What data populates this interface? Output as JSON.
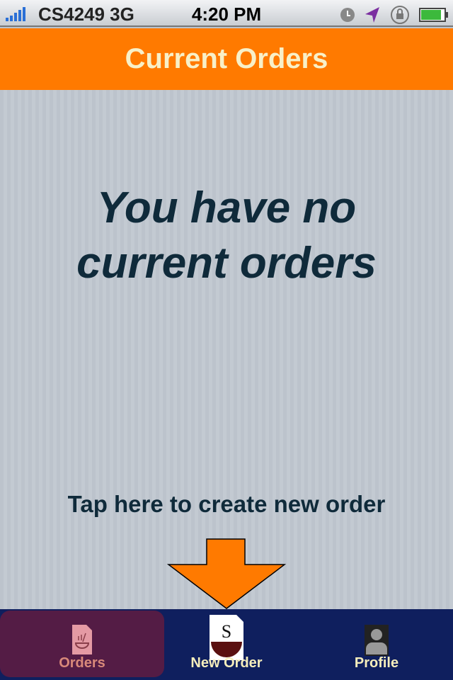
{
  "status_bar": {
    "carrier": "CS4249 3G",
    "time": "4:20 PM",
    "icons": [
      "signal-icon",
      "clock-icon",
      "location-icon",
      "rotation-lock-icon",
      "battery-icon"
    ]
  },
  "nav": {
    "title": "Current Orders"
  },
  "main": {
    "empty_line1": "You have no",
    "empty_line2": "current orders",
    "hint": "Tap here to create new order"
  },
  "tabs": [
    {
      "label": "Orders",
      "selected": true
    },
    {
      "label": "New Order"
    },
    {
      "label": "Profile"
    }
  ],
  "colors": {
    "nav": "#ff7a00",
    "tabbar": "#0f1f5e",
    "selected_tab": "#541c45",
    "arrow": "#ff7a00"
  }
}
